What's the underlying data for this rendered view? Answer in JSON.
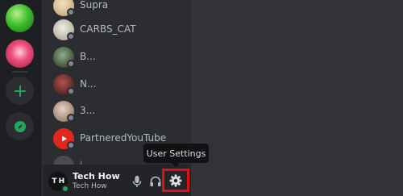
{
  "servers": [
    {
      "name": "green-server-icon",
      "color": "#3fbf2f"
    },
    {
      "name": "pink-server-icon",
      "color": "#f0507e"
    }
  ],
  "rail": {
    "add_icon": "plus-icon",
    "explore_icon": "compass-icon",
    "accent": "#23a55a"
  },
  "dms": [
    {
      "name": "Supra",
      "avatar_color": "#d9c4a0"
    },
    {
      "name": "CARBS_CAT",
      "avatar_color": "#c9c3b3"
    },
    {
      "name": "B...",
      "avatar_color": "#3b5a3a"
    },
    {
      "name": "N...",
      "avatar_color": "#6a2a2a"
    },
    {
      "name": "3...",
      "avatar_color": "#b79a85"
    },
    {
      "name": "PartneredYouTube",
      "avatar_color": "#e0281c"
    }
  ],
  "user": {
    "avatar_text": "T H",
    "name": "Tech How",
    "subtext": "Tech How",
    "status_color": "#23a55a"
  },
  "controls": {
    "mic_icon": "microphone-icon",
    "headphones_icon": "headphones-icon",
    "settings_icon": "gear-icon"
  },
  "tooltip": {
    "text": "User Settings"
  },
  "highlight_color": "#e0101a"
}
